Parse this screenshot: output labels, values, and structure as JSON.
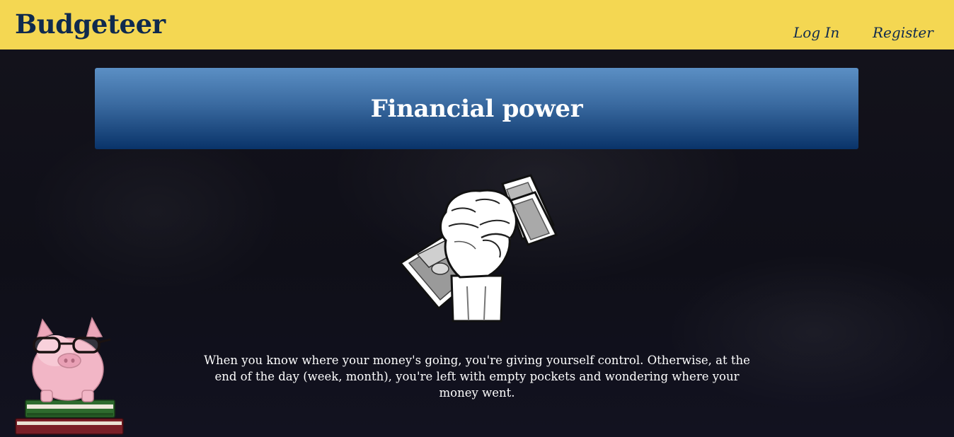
{
  "brand": {
    "name": "Budgeteer"
  },
  "nav": {
    "login_label": "Log In",
    "register_label": "Register"
  },
  "hero": {
    "title": "Financial power",
    "text": "When you know where your money's going, you're giving yourself control. Otherwise, at the end of the day (week, month), you're left with empty pockets and wondering where your money went."
  },
  "images": {
    "fist": "fist-holding-cash",
    "piggy": "piggy-bank-with-glasses-on-books"
  },
  "colors": {
    "navbar": "#f4d752",
    "brand_text": "#0f2a4e",
    "banner_top": "#5b8fc4",
    "banner_bottom": "#093369",
    "background": "#14131c"
  }
}
